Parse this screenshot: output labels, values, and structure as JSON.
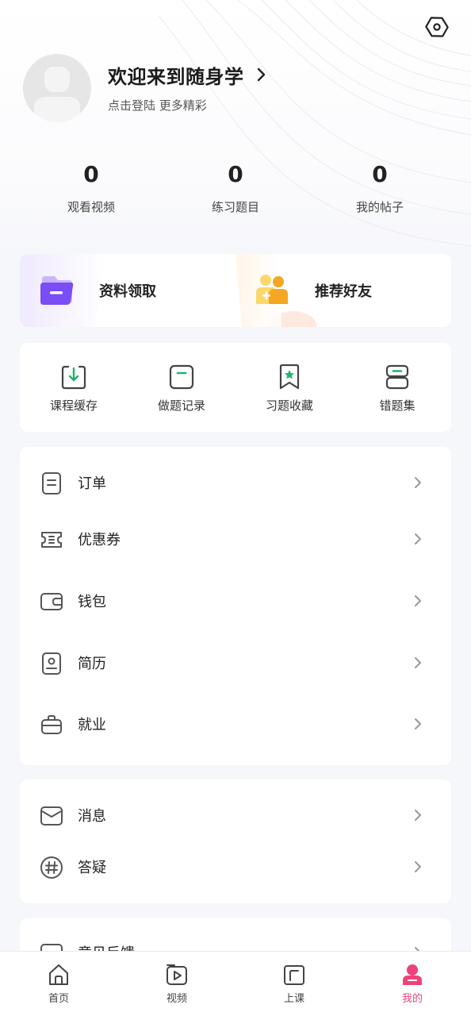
{
  "header": {
    "welcome_title": "欢迎来到随身学",
    "welcome_subtitle": "点击登陆 更多精彩"
  },
  "stats": [
    {
      "value": "0",
      "label": "观看视频"
    },
    {
      "value": "0",
      "label": "练习题目"
    },
    {
      "value": "0",
      "label": "我的帖子"
    }
  ],
  "promo": [
    {
      "label": "资料领取",
      "icon": "folder-icon"
    },
    {
      "label": "推荐好友",
      "icon": "add-friends-icon"
    }
  ],
  "quick": [
    {
      "label": "课程缓存",
      "icon": "download-icon"
    },
    {
      "label": "做题记录",
      "icon": "record-icon"
    },
    {
      "label": "习题收藏",
      "icon": "bookmark-star-icon"
    },
    {
      "label": "错题集",
      "icon": "wrong-set-icon"
    }
  ],
  "menu": [
    {
      "label": "订单",
      "icon": "order-icon"
    },
    {
      "label": "优惠券",
      "icon": "coupon-icon"
    },
    {
      "label": "钱包",
      "icon": "wallet-icon"
    },
    {
      "label": "简历",
      "icon": "resume-icon"
    },
    {
      "label": "就业",
      "icon": "briefcase-icon"
    }
  ],
  "menu2": [
    {
      "label": "消息",
      "icon": "mail-icon"
    },
    {
      "label": "答疑",
      "icon": "hash-icon"
    }
  ],
  "menu3": [
    {
      "label": "意见反馈",
      "icon": "feedback-icon"
    }
  ],
  "tabs": [
    {
      "label": "首页",
      "icon": "home-icon"
    },
    {
      "label": "视频",
      "icon": "video-icon"
    },
    {
      "label": "上课",
      "icon": "class-icon"
    },
    {
      "label": "我的",
      "icon": "profile-icon",
      "active": true
    }
  ],
  "colors": {
    "accent": "#f0427a",
    "green": "#1fb36b",
    "icon_gray": "#555555",
    "promo_purple": "#7b4df5",
    "promo_orange": "#f5a623"
  }
}
